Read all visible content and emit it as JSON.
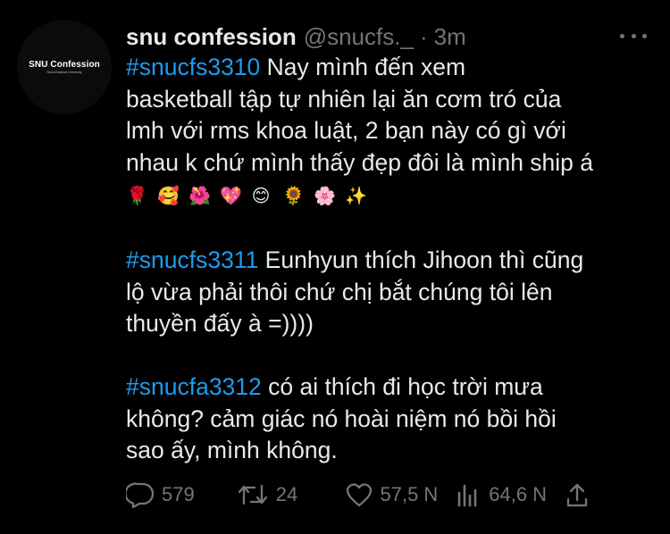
{
  "avatar": {
    "title": "SNU Confession",
    "subtitle": "Seoul National University"
  },
  "header": {
    "display_name": "snu confession",
    "handle": "@snucfs._",
    "separator": "·",
    "time": "3m"
  },
  "tweet": {
    "p1": {
      "tag": "#snucfs3310",
      "lines": [
        " Nay mình đến xem",
        "basketball tập tự nhiên lại ăn cơm tró của",
        "lmh với rms khoa luật, 2 bạn này có gì với",
        "nhau k chứ mình thấy đẹp đôi là mình ship á"
      ],
      "emojis": [
        "🌹",
        "🥰",
        "🌺",
        "💖",
        "😊",
        "🌻",
        "🌸",
        "✨"
      ]
    },
    "p2": {
      "tag": "#snucfs3311",
      "lines": [
        " Eunhyun thích Jihoon thì cũng",
        "lộ vừa phải thôi chứ chị bắt chúng tôi lên",
        "thuyền đấy à =))))"
      ]
    },
    "p3": {
      "tag": "#snucfa3312",
      "lines": [
        " có ai thích đi học trời mưa",
        "không? cảm giác nó hoài niệm nó bồi hồi",
        "sao ấy, mình không."
      ]
    }
  },
  "actions": {
    "reply_count": "579",
    "retweet_count": "24",
    "like_count": "57,5 N",
    "views_count": "64,6 N"
  },
  "icons": {
    "reply": "reply-icon",
    "retweet": "retweet-icon",
    "like": "heart-icon",
    "views": "views-icon",
    "share": "share-icon",
    "more": "more-icon"
  },
  "colors": {
    "background": "#000000",
    "text": "#e7e9ea",
    "muted": "#71767b",
    "hashtag": "#1d9bf0"
  }
}
